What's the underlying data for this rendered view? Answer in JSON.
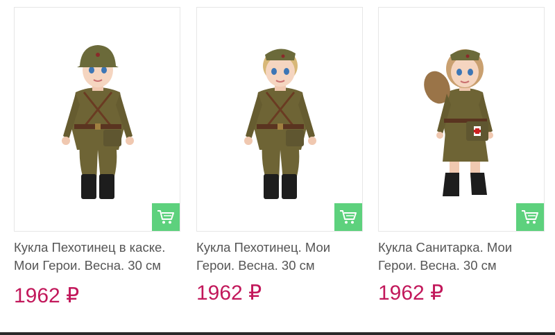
{
  "products": [
    {
      "title": "Кукла Пехотинец в каске. Мои Герои. Весна. 30 см",
      "price": "1962 ₽",
      "cart_icon": "cart-icon"
    },
    {
      "title": "Кукла Пехотинец. Мои Герои. Весна. 30 см",
      "price": "1962 ₽",
      "cart_icon": "cart-icon"
    },
    {
      "title": "Кукла Санитарка. Мои Герои. Весна. 30 см",
      "price": "1962 ₽",
      "cart_icon": "cart-icon"
    }
  ],
  "colors": {
    "price": "#c2185b",
    "cart_button": "#5dd17d",
    "uniform": "#6e6435",
    "boots": "#1d1d1d"
  }
}
